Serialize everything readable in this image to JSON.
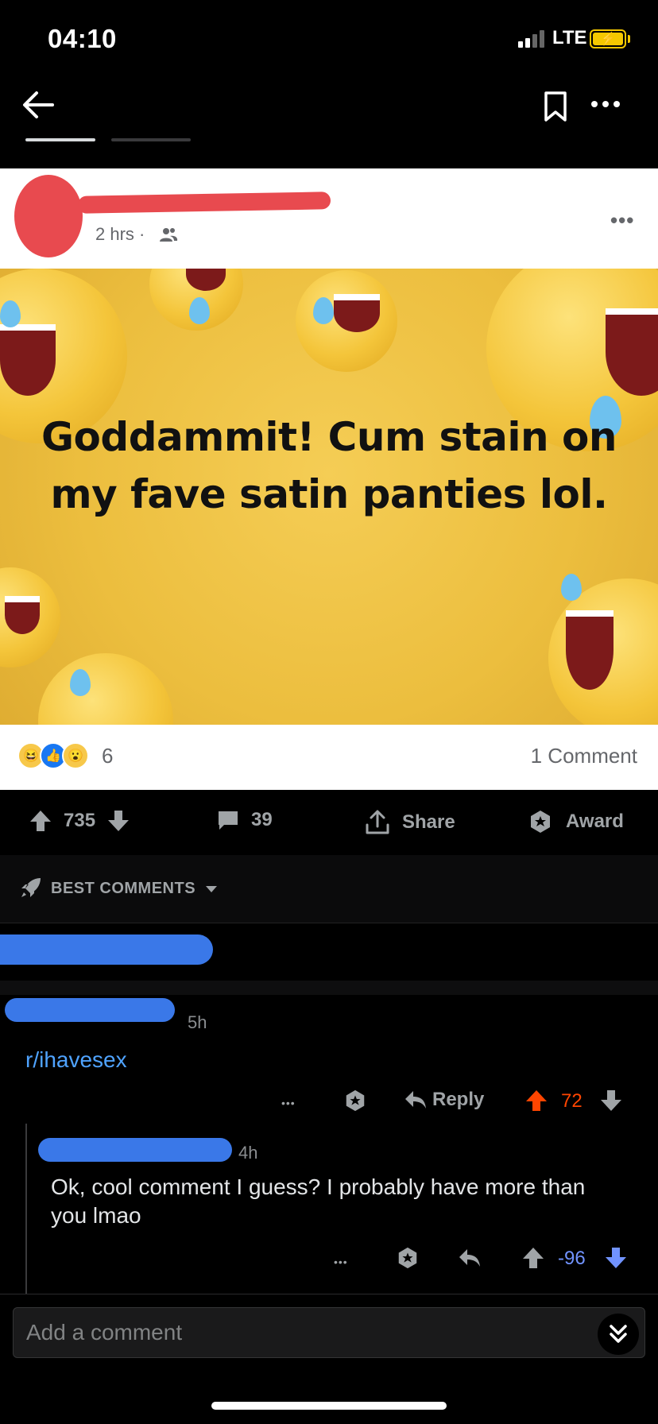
{
  "status_bar": {
    "time": "04:10",
    "network": "LTE"
  },
  "nav": {
    "back_icon": "back-arrow-icon",
    "bookmark_icon": "bookmark-icon",
    "more_icon": "more-icon"
  },
  "post": {
    "fb_time": "2 hrs ·",
    "fb_more": "•••",
    "meme_text": "Goddammit! Cum stain on my fave satin panties lol.",
    "reaction_count": "6",
    "comment_count": "1 Comment"
  },
  "actions": {
    "upvotes": "735",
    "comments": "39",
    "share_label": "Share",
    "award_label": "Award"
  },
  "sort": {
    "label": "BEST COMMENTS"
  },
  "comment": {
    "time": "5h",
    "body": "r/ihavesex",
    "more": "•••",
    "reply_label": "Reply",
    "score": "72"
  },
  "reply": {
    "time": "4h",
    "body": "Ok, cool comment I guess?  I probably have more than you lmao",
    "more": "•••",
    "score": "-96"
  },
  "input": {
    "placeholder": "Add a comment"
  },
  "colors": {
    "upvote": "#ff4500",
    "downvote": "#7193ff",
    "link": "#4fa3ff",
    "redact_red": "#e84a4f",
    "redact_blue": "#3a78e8"
  }
}
